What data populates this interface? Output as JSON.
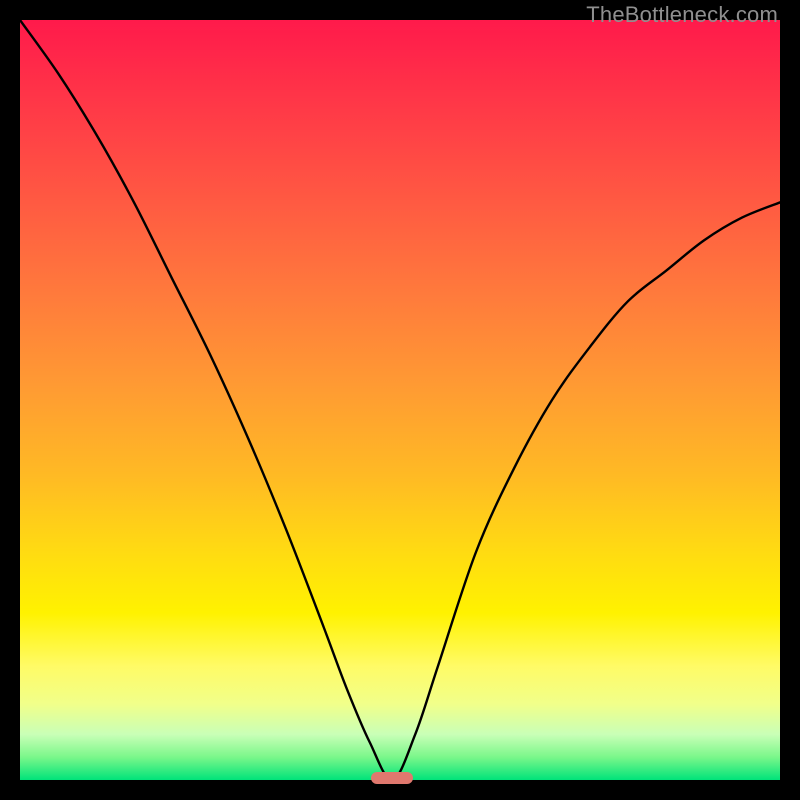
{
  "watermark": "TheBottleneck.com",
  "colors": {
    "frame_bg": "#000000",
    "gradient_top": "#ff1a4b",
    "gradient_mid": "#ffdb12",
    "gradient_bottom": "#00e37a",
    "curve": "#000000",
    "marker": "#e0786e",
    "watermark_text": "#8f8f8f"
  },
  "chart_data": {
    "type": "line",
    "title": "",
    "xlabel": "",
    "ylabel": "",
    "xlim": [
      0,
      1
    ],
    "ylim": [
      0,
      1
    ],
    "series": [
      {
        "name": "bottleneck-curve",
        "x": [
          0.0,
          0.05,
          0.1,
          0.15,
          0.2,
          0.25,
          0.3,
          0.35,
          0.4,
          0.43,
          0.46,
          0.49,
          0.52,
          0.55,
          0.6,
          0.65,
          0.7,
          0.75,
          0.8,
          0.85,
          0.9,
          0.95,
          1.0
        ],
        "y": [
          1.0,
          0.93,
          0.85,
          0.76,
          0.66,
          0.56,
          0.45,
          0.33,
          0.2,
          0.12,
          0.05,
          0.0,
          0.06,
          0.15,
          0.3,
          0.41,
          0.5,
          0.57,
          0.63,
          0.67,
          0.71,
          0.74,
          0.76
        ]
      }
    ],
    "marker": {
      "x": 0.49,
      "y": 0.0
    },
    "annotations": [
      {
        "text": "TheBottleneck.com",
        "pos": "top-right"
      }
    ]
  }
}
